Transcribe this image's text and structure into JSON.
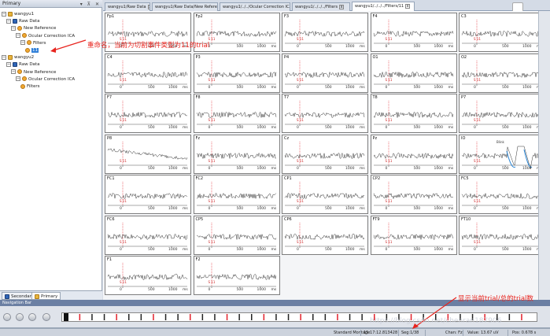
{
  "left_panel": {
    "title": "Primary",
    "header_buttons": "▾ ⊼ ✕",
    "tree": [
      {
        "label": "wangyu1",
        "indent": 0,
        "expander": "−",
        "icon": "folder"
      },
      {
        "label": "Raw Data",
        "indent": 1,
        "expander": "−",
        "icon": "grid"
      },
      {
        "label": "New Reference",
        "indent": 2,
        "expander": "−",
        "icon": "gear"
      },
      {
        "label": "Ocular Correction ICA",
        "indent": 3,
        "expander": "−",
        "icon": "gear"
      },
      {
        "label": "Filters",
        "indent": 4,
        "expander": "−",
        "icon": "gear"
      },
      {
        "label": "11",
        "indent": 5,
        "expander": "",
        "icon": "gear",
        "selected": true
      },
      {
        "label": "wangyu2",
        "indent": 0,
        "expander": "−",
        "icon": "folder"
      },
      {
        "label": "Raw Data",
        "indent": 1,
        "expander": "−",
        "icon": "grid"
      },
      {
        "label": "New Reference",
        "indent": 2,
        "expander": "−",
        "icon": "gear"
      },
      {
        "label": "Ocular Correction ICA",
        "indent": 3,
        "expander": "−",
        "icon": "gear"
      },
      {
        "label": "Filters",
        "indent": 4,
        "expander": "",
        "icon": "gear"
      }
    ],
    "bottom_tabs": {
      "secondary": "Secondary",
      "primary": "Primary"
    }
  },
  "tabs": [
    {
      "label": "wangyu1/Raw Data",
      "close": "x"
    },
    {
      "label": "wangyu1/Raw Data/New Reference",
      "close": "x"
    },
    {
      "label": "wangyu1/../../Ocular Correction ICA",
      "close": "x"
    },
    {
      "label": "wangyu1/../../../Filters",
      "close": "x"
    },
    {
      "label": "wangyu1/../../../Filters/11",
      "close": "x",
      "active": true
    }
  ],
  "axis": {
    "ticks": [
      "0",
      "500",
      "1000"
    ],
    "unit": "ms",
    "marker": "S 11"
  },
  "channels": [
    "Fp1",
    "Fp2",
    "F3",
    "F4",
    "C3",
    "C4",
    "P3",
    "P4",
    "O1",
    "O2",
    "F7",
    "F8",
    "T7",
    "T8",
    "P7",
    "P8",
    "Fz",
    "Cz",
    "Pz",
    "IO",
    "FC1",
    "FC2",
    "CP1",
    "CP2",
    "FC5",
    "FC6",
    "CP5",
    "CP6",
    "FT9",
    "FT10",
    "F1",
    "F2"
  ],
  "io_annotation": "Blink",
  "navigation": {
    "title": "Navigation Bar"
  },
  "status": {
    "montage": "Standard Montage",
    "time": "15:17:12.813428",
    "seg": "Seg:1/38",
    "chan": "Chan: Fz",
    "value": "Value: 13.67 uV",
    "pos": "Pos: 0.678 s"
  },
  "annotations": {
    "rename_note": "重命名，当前为切割事件类型为11的trial",
    "trial_note": "显示当前trial/总的trial数"
  },
  "watermark": "https://blog.csdn.net/chenran187906",
  "colors": {
    "annotation": "#e8241e",
    "trace": "#333333",
    "marker": "#e2202a",
    "selection": "#2f7fd8"
  }
}
